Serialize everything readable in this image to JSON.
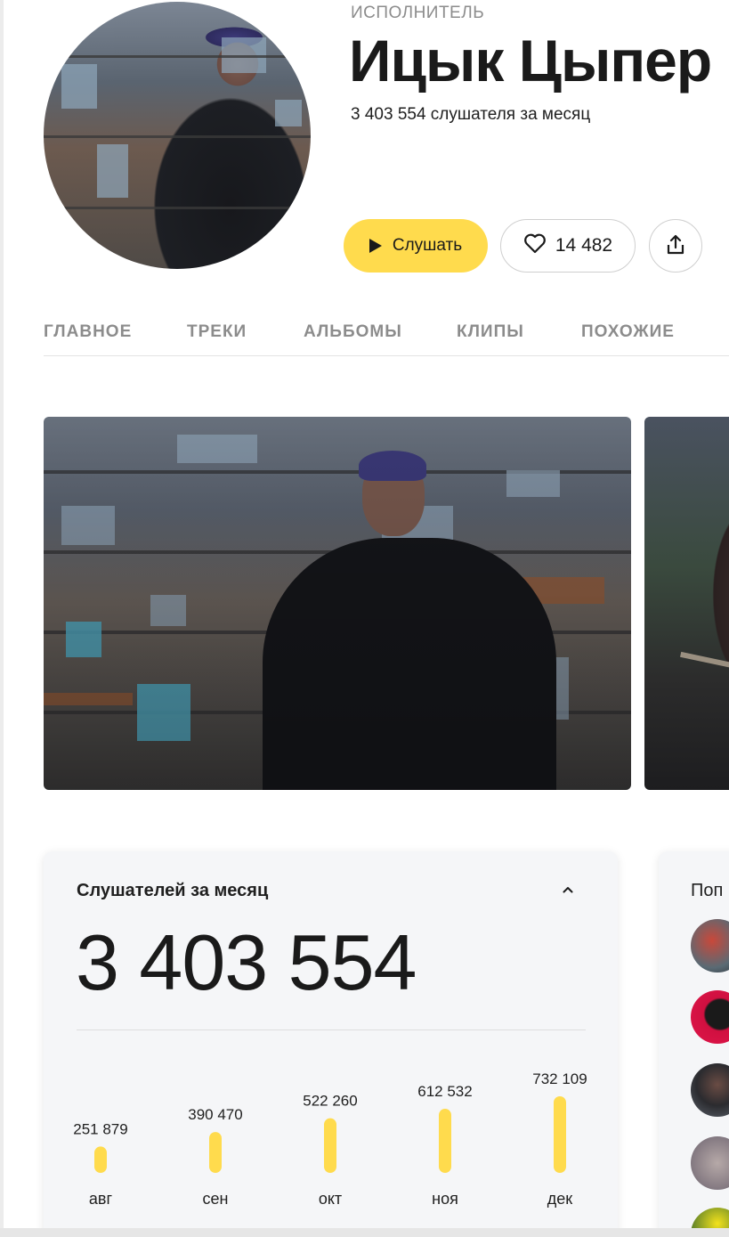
{
  "header": {
    "eyebrow": "ИСПОЛНИТЕЛЬ",
    "artist_name": "Ицык Цыпер",
    "monthly_listeners_text": "3 403 554 слушателя за месяц"
  },
  "actions": {
    "play_label": "Слушать",
    "likes_count": "14 482"
  },
  "tabs": [
    {
      "label": "ГЛАВНОЕ"
    },
    {
      "label": "ТРЕКИ"
    },
    {
      "label": "АЛЬБОМЫ"
    },
    {
      "label": "КЛИПЫ"
    },
    {
      "label": "ПОХОЖИЕ"
    }
  ],
  "stats_card": {
    "title": "Слушателей за месяц",
    "total": "3 403 554"
  },
  "side_card": {
    "title": "Поп"
  },
  "colors": {
    "accent": "#ffdb4d",
    "muted_text": "#8c8c8c",
    "card_bg": "#f5f6f8"
  },
  "chart_data": {
    "type": "bar",
    "categories": [
      "авг",
      "сен",
      "окт",
      "ноя",
      "дек"
    ],
    "values": [
      251879,
      390470,
      522260,
      612532,
      732109
    ],
    "value_labels": [
      "251 879",
      "390 470",
      "522 260",
      "612 532",
      "732 109"
    ],
    "title": "",
    "xlabel": "",
    "ylabel": "",
    "color": "#ffdb4d"
  }
}
